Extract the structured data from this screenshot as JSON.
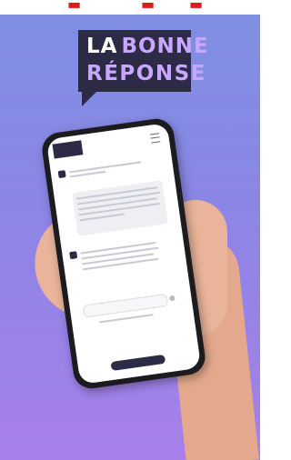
{
  "logo": {
    "word1": "LA",
    "word2": "BONNE",
    "word3": "RÉPONSE"
  },
  "colors": {
    "brand_dark": "#2c2a45",
    "brand_accent": "#c7a7ff",
    "bg_top": "#7e8fe0",
    "bg_bottom": "#a77fe8"
  },
  "icons": {
    "menu": "hamburger-menu-icon",
    "send": "send-icon"
  }
}
